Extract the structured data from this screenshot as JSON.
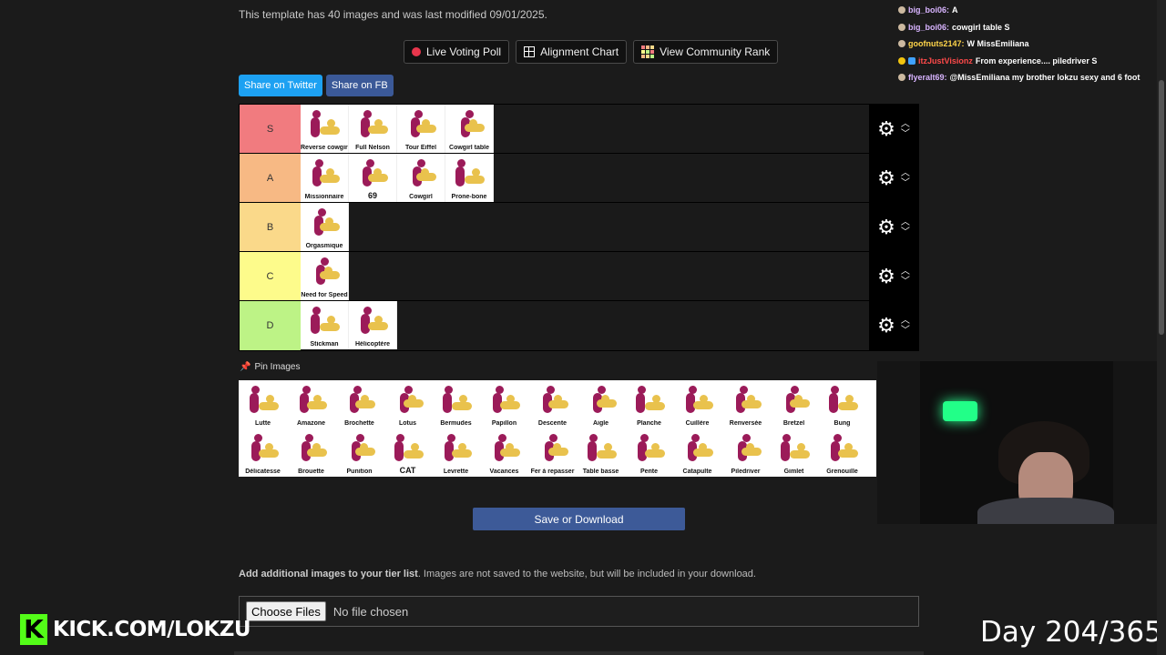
{
  "page": {
    "info": "This template has 40 images and was last modified 09/01/2025."
  },
  "actions": [
    {
      "label": "Live Voting Poll",
      "icon": "red-dot-icon"
    },
    {
      "label": "Alignment Chart",
      "icon": "grid-icon"
    },
    {
      "label": "View Community Rank",
      "icon": "rank-grid-icon"
    }
  ],
  "share": {
    "twitter": "Share on Twitter",
    "fb": "Share on FB"
  },
  "tiers": [
    {
      "label": "S",
      "color": "#f17b7f",
      "items": [
        "Reverse cowgirl",
        "Full Nelson",
        "Tour Eiffel",
        "Cowgirl table"
      ]
    },
    {
      "label": "A",
      "color": "#f7b984",
      "items": [
        "Missionnaire",
        "69",
        "Cowgirl",
        "Prone-bone"
      ]
    },
    {
      "label": "B",
      "color": "#fad98a",
      "items": [
        "Orgasmique"
      ]
    },
    {
      "label": "C",
      "color": "#fdfb8b",
      "items": [
        "Need for Speed"
      ]
    },
    {
      "label": "D",
      "color": "#bdf386",
      "items": [
        "Stickman",
        "Hélicoptère"
      ]
    }
  ],
  "pin": {
    "label": "Pin Images"
  },
  "pool": [
    "Lutte",
    "Amazone",
    "Brochette",
    "Lotus",
    "Bermudes",
    "Papillon",
    "Descente",
    "Aigle",
    "Planche",
    "Cuillère",
    "Renversée",
    "Bretzel",
    "Bung",
    "Délicatesse",
    "Brouette",
    "Punition",
    "CAT",
    "Levrette",
    "Vacances",
    "Fer à repasser",
    "Table basse",
    "Pente",
    "Catapulte",
    "Piledriver",
    "Gimlet",
    "Grenouille"
  ],
  "save": "Save or Download",
  "add": {
    "bold": "Add additional images to your tier list",
    "rest": ". Images are not saved to the website, but will be included in your download."
  },
  "file": {
    "button": "Choose Files",
    "status": "No file chosen"
  },
  "chat": [
    {
      "user": "big_boi06:",
      "msg": "A",
      "color": "#d8b4ff"
    },
    {
      "user": "big_boi06:",
      "msg": "cowgirl table S",
      "color": "#d8b4ff"
    },
    {
      "user": "goofnuts2147:",
      "msg": "W MissEmiliana",
      "color": "#ffd54a"
    },
    {
      "user": "itzJustVisionz",
      "msg": "From experience.... piledriver S",
      "color": "#ff4a4a"
    },
    {
      "user": "flyeralt69:",
      "msg": "@MissEmiliana my brother lokzu sexy and 6 foot",
      "color": "#d8b4ff"
    }
  ],
  "overlay": {
    "kick": "KICK.COM/LOKZU",
    "kick_logo": "K",
    "day": "Day 204/365"
  },
  "colors": {
    "figure_a": "#9b1b59",
    "figure_b": "#e9c24d"
  }
}
